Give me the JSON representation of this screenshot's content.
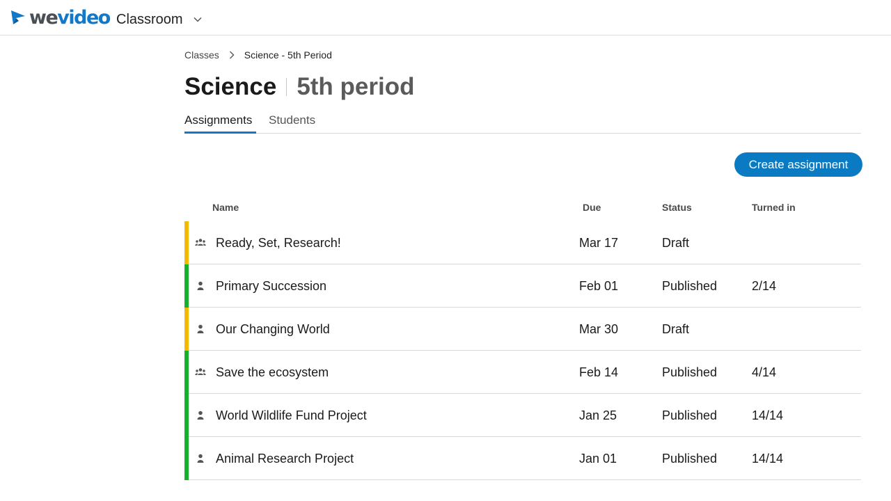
{
  "header": {
    "logo_we": "we",
    "logo_video": "video",
    "product": "Classroom",
    "product_chevron_icon": "chevron-down-icon"
  },
  "breadcrumb": {
    "parent": "Classes",
    "separator_icon": "chevron-right-icon",
    "current": "Science - 5th Period"
  },
  "page": {
    "title": "Science",
    "subtitle": "5th period"
  },
  "tabs": [
    {
      "label": "Assignments",
      "active": true
    },
    {
      "label": "Students",
      "active": false
    }
  ],
  "actions": {
    "create_label": "Create assignment"
  },
  "table": {
    "columns": {
      "name": "Name",
      "due": "Due",
      "status": "Status",
      "turned_in": "Turned in"
    },
    "rows": [
      {
        "type_icon": "group-icon",
        "name": "Ready, Set, Research!",
        "due": "Mar 17",
        "status": "Draft",
        "turned_in": ""
      },
      {
        "type_icon": "person-icon",
        "name": "Primary Succession",
        "due": "Feb 01",
        "status": "Published",
        "turned_in": "2/14"
      },
      {
        "type_icon": "person-icon",
        "name": "Our Changing World",
        "due": "Mar 30",
        "status": "Draft",
        "turned_in": ""
      },
      {
        "type_icon": "group-icon",
        "name": "Save the ecosystem",
        "due": "Feb 14",
        "status": "Published",
        "turned_in": "4/14"
      },
      {
        "type_icon": "person-icon",
        "name": "World Wildlife Fund Project",
        "due": "Jan 25",
        "status": "Published",
        "turned_in": "14/14"
      },
      {
        "type_icon": "person-icon",
        "name": "Animal Research Project",
        "due": "Jan 01",
        "status": "Published",
        "turned_in": "14/14"
      }
    ]
  },
  "colors": {
    "accent": "#1378c8",
    "button": "#0a7ac2",
    "draft": "#f5b800",
    "published": "#16b02c"
  }
}
